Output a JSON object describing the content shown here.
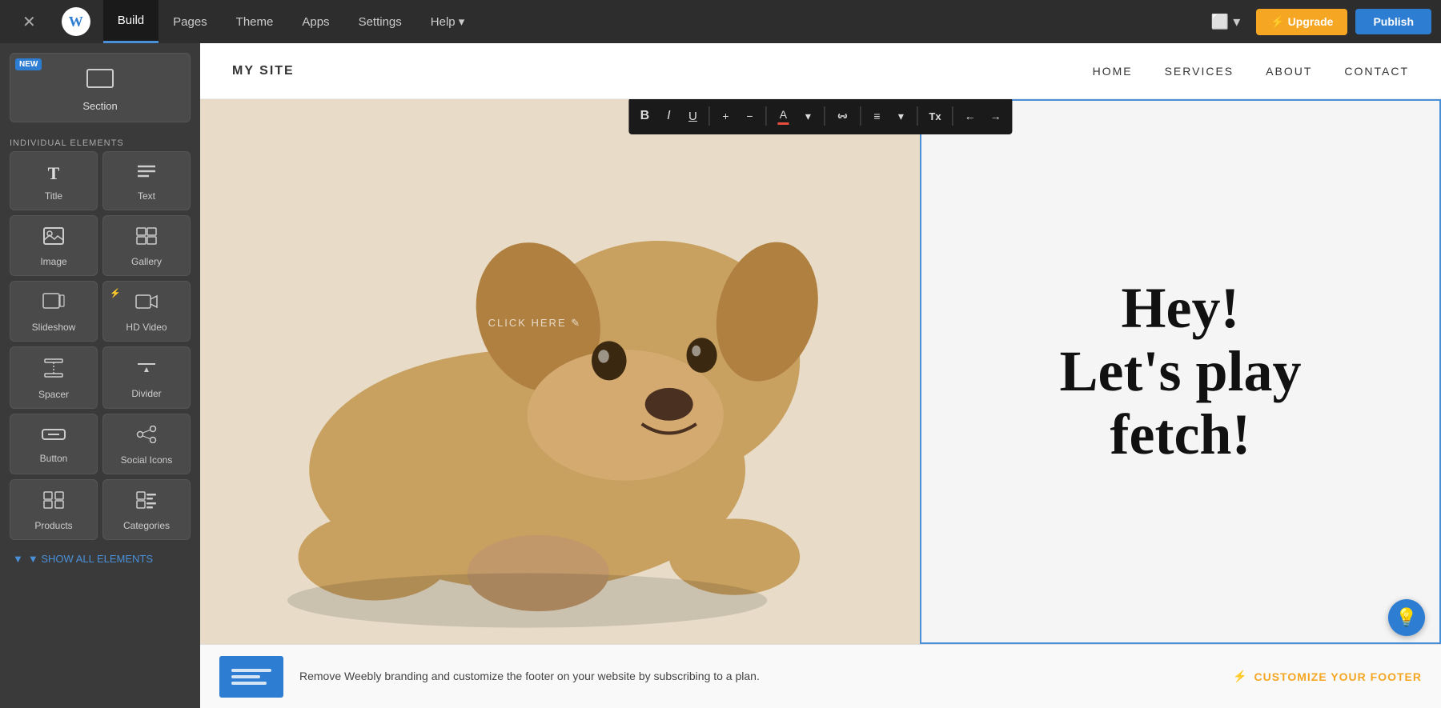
{
  "topNav": {
    "closeLabel": "✕",
    "logoText": "W",
    "items": [
      {
        "label": "Build",
        "active": true
      },
      {
        "label": "Pages",
        "active": false
      },
      {
        "label": "Theme",
        "active": false
      },
      {
        "label": "Apps",
        "active": false
      },
      {
        "label": "Settings",
        "active": false
      },
      {
        "label": "Help ▾",
        "active": false
      }
    ],
    "deviceLabel": "⬜ ▾",
    "upgradeLabel": "⚡ Upgrade",
    "publishLabel": "Publish"
  },
  "sidebar": {
    "sectionLabel": "Section",
    "newBadge": "NEW",
    "groupLabel": "INDIVIDUAL ELEMENTS",
    "items": [
      {
        "id": "title",
        "label": "Title",
        "icon": "T"
      },
      {
        "id": "text",
        "label": "Text",
        "icon": "≡"
      },
      {
        "id": "image",
        "label": "Image",
        "icon": "🖼"
      },
      {
        "id": "gallery",
        "label": "Gallery",
        "icon": "⊞"
      },
      {
        "id": "slideshow",
        "label": "Slideshow",
        "icon": "🖼›"
      },
      {
        "id": "hdvideo",
        "label": "HD Video",
        "icon": "▶",
        "badge": "⚡"
      },
      {
        "id": "spacer",
        "label": "Spacer",
        "icon": "↕"
      },
      {
        "id": "divider",
        "label": "Divider",
        "icon": "÷"
      },
      {
        "id": "button",
        "label": "Button",
        "icon": "▬"
      },
      {
        "id": "socialicons",
        "label": "Social Icons",
        "icon": "⊕"
      },
      {
        "id": "products",
        "label": "Products",
        "icon": "⊞"
      },
      {
        "id": "categories",
        "label": "Categories",
        "icon": "⊟"
      }
    ],
    "showAllLabel": "▼ SHOW ALL ELEMENTS"
  },
  "siteHeader": {
    "logo": "MY SITE",
    "navItems": [
      "HOME",
      "SERVICES",
      "ABOUT",
      "CONTACT"
    ]
  },
  "hero": {
    "clickHint": "CLICK HERE ✎",
    "text": "Hey!\nLet's play\nfetch!"
  },
  "formatToolbar": {
    "buttons": [
      {
        "id": "bold",
        "label": "B",
        "class": "bold"
      },
      {
        "id": "italic",
        "label": "I",
        "class": "italic"
      },
      {
        "id": "underline",
        "label": "U",
        "class": "underline"
      },
      {
        "id": "plus",
        "label": "+"
      },
      {
        "id": "minus",
        "label": "−"
      },
      {
        "id": "color",
        "label": "A"
      },
      {
        "id": "link",
        "label": "🔗"
      },
      {
        "id": "align",
        "label": "≡"
      },
      {
        "id": "tx",
        "label": "Tx"
      },
      {
        "id": "undo",
        "label": "←"
      },
      {
        "id": "redo",
        "label": "→"
      }
    ]
  },
  "footerBanner": {
    "previewLines": [
      60,
      40,
      50
    ],
    "text": "Remove Weebly branding and customize the footer on your website by subscribing to a plan.",
    "customizeLabel": "CUSTOMIZE YOUR FOOTER",
    "lightningIcon": "⚡"
  },
  "helpFab": {
    "icon": "💡"
  }
}
